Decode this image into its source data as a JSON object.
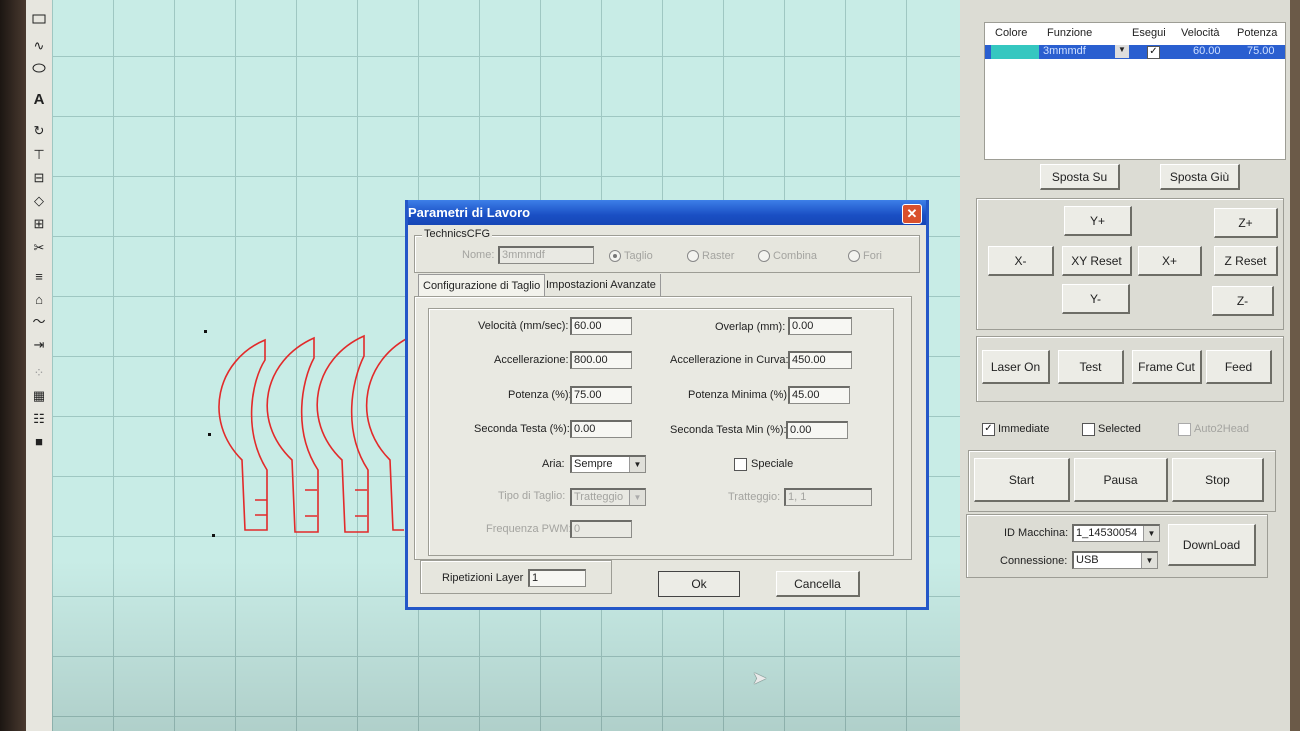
{
  "toolbar": {
    "icons": [
      "rectangle-icon",
      "curve-icon",
      "ellipse-icon",
      "text-icon",
      "rotate-icon",
      "align-top-icon",
      "align-center-icon",
      "node-edit-icon",
      "distribute-icon",
      "scissors-icon",
      "hatch-icon",
      "array-icon",
      "smooth-icon",
      "trim-icon",
      "grid-dots-icon",
      "group-icon",
      "table-icon",
      "fill-icon"
    ],
    "text_tool": "A"
  },
  "layer_table": {
    "headers": [
      "Colore",
      "Funzione",
      "Esegui",
      "Velocità",
      "Potenza"
    ],
    "row": {
      "color": "#35c7c0",
      "funzione": "3mmmdf",
      "esegui": "✓",
      "velocita": "60.00",
      "potenza": "75.00"
    }
  },
  "layer_buttons": {
    "up": "Sposta Su",
    "down": "Sposta Giù"
  },
  "motion": {
    "y_plus": "Y+",
    "z_plus": "Z+",
    "x_minus": "X-",
    "xy_reset": "XY Reset",
    "x_plus": "X+",
    "z_reset": "Z Reset",
    "y_minus": "Y-",
    "z_minus": "Z-"
  },
  "laser": {
    "laser_on": "Laser On",
    "test": "Test",
    "frame_cut": "Frame Cut",
    "feed": "Feed"
  },
  "options": {
    "immediate": "Immediate",
    "selected": "Selected",
    "auto2head": "Auto2Head",
    "immediate_checked": "✓"
  },
  "run": {
    "start": "Start",
    "pause": "Pausa",
    "stop": "Stop"
  },
  "machine": {
    "id_label": "ID Macchina:",
    "id_value": "1_14530054",
    "conn_label": "Connessione:",
    "conn_value": "USB",
    "download": "DownLoad"
  },
  "dialog": {
    "title": "Parametri di Lavoro",
    "close": "✕",
    "group_label": "TechnicsCFG",
    "name_label": "Nome:",
    "name_value": "3mmmdf",
    "modes": [
      "Taglio",
      "Raster",
      "Combina",
      "Fori"
    ],
    "tabs": [
      "Configurazione di Taglio",
      "Impostazioni Avanzate"
    ],
    "fields": {
      "velocita_label": "Velocità (mm/sec):",
      "velocita": "60.00",
      "overlap_label": "Overlap (mm):",
      "overlap": "0.00",
      "accel_label": "Accellerazione:",
      "accel": "800.00",
      "accel_curve_label": "Accellerazione in Curva:",
      "accel_curve": "450.00",
      "potenza_label": "Potenza (%):",
      "potenza": "75.00",
      "potenza_min_label": "Potenza Minima (%):",
      "potenza_min": "45.00",
      "seconda_label": "Seconda Testa (%):",
      "seconda": "0.00",
      "seconda_min_label": "Seconda Testa Min (%):",
      "seconda_min": "0.00",
      "aria_label": "Aria:",
      "aria": "Sempre",
      "speciale_label": "Speciale",
      "tipo_label": "Tipo di Taglio:",
      "tipo": "Tratteggio",
      "tratteggio_label": "Tratteggio:",
      "tratteggio": "1, 1",
      "pwm_label": "Frequenza PWM:",
      "pwm": "0"
    },
    "ripetizioni_label": "Ripetizioni Layer",
    "ripetizioni": "1",
    "ok": "Ok",
    "cancel": "Cancella"
  }
}
